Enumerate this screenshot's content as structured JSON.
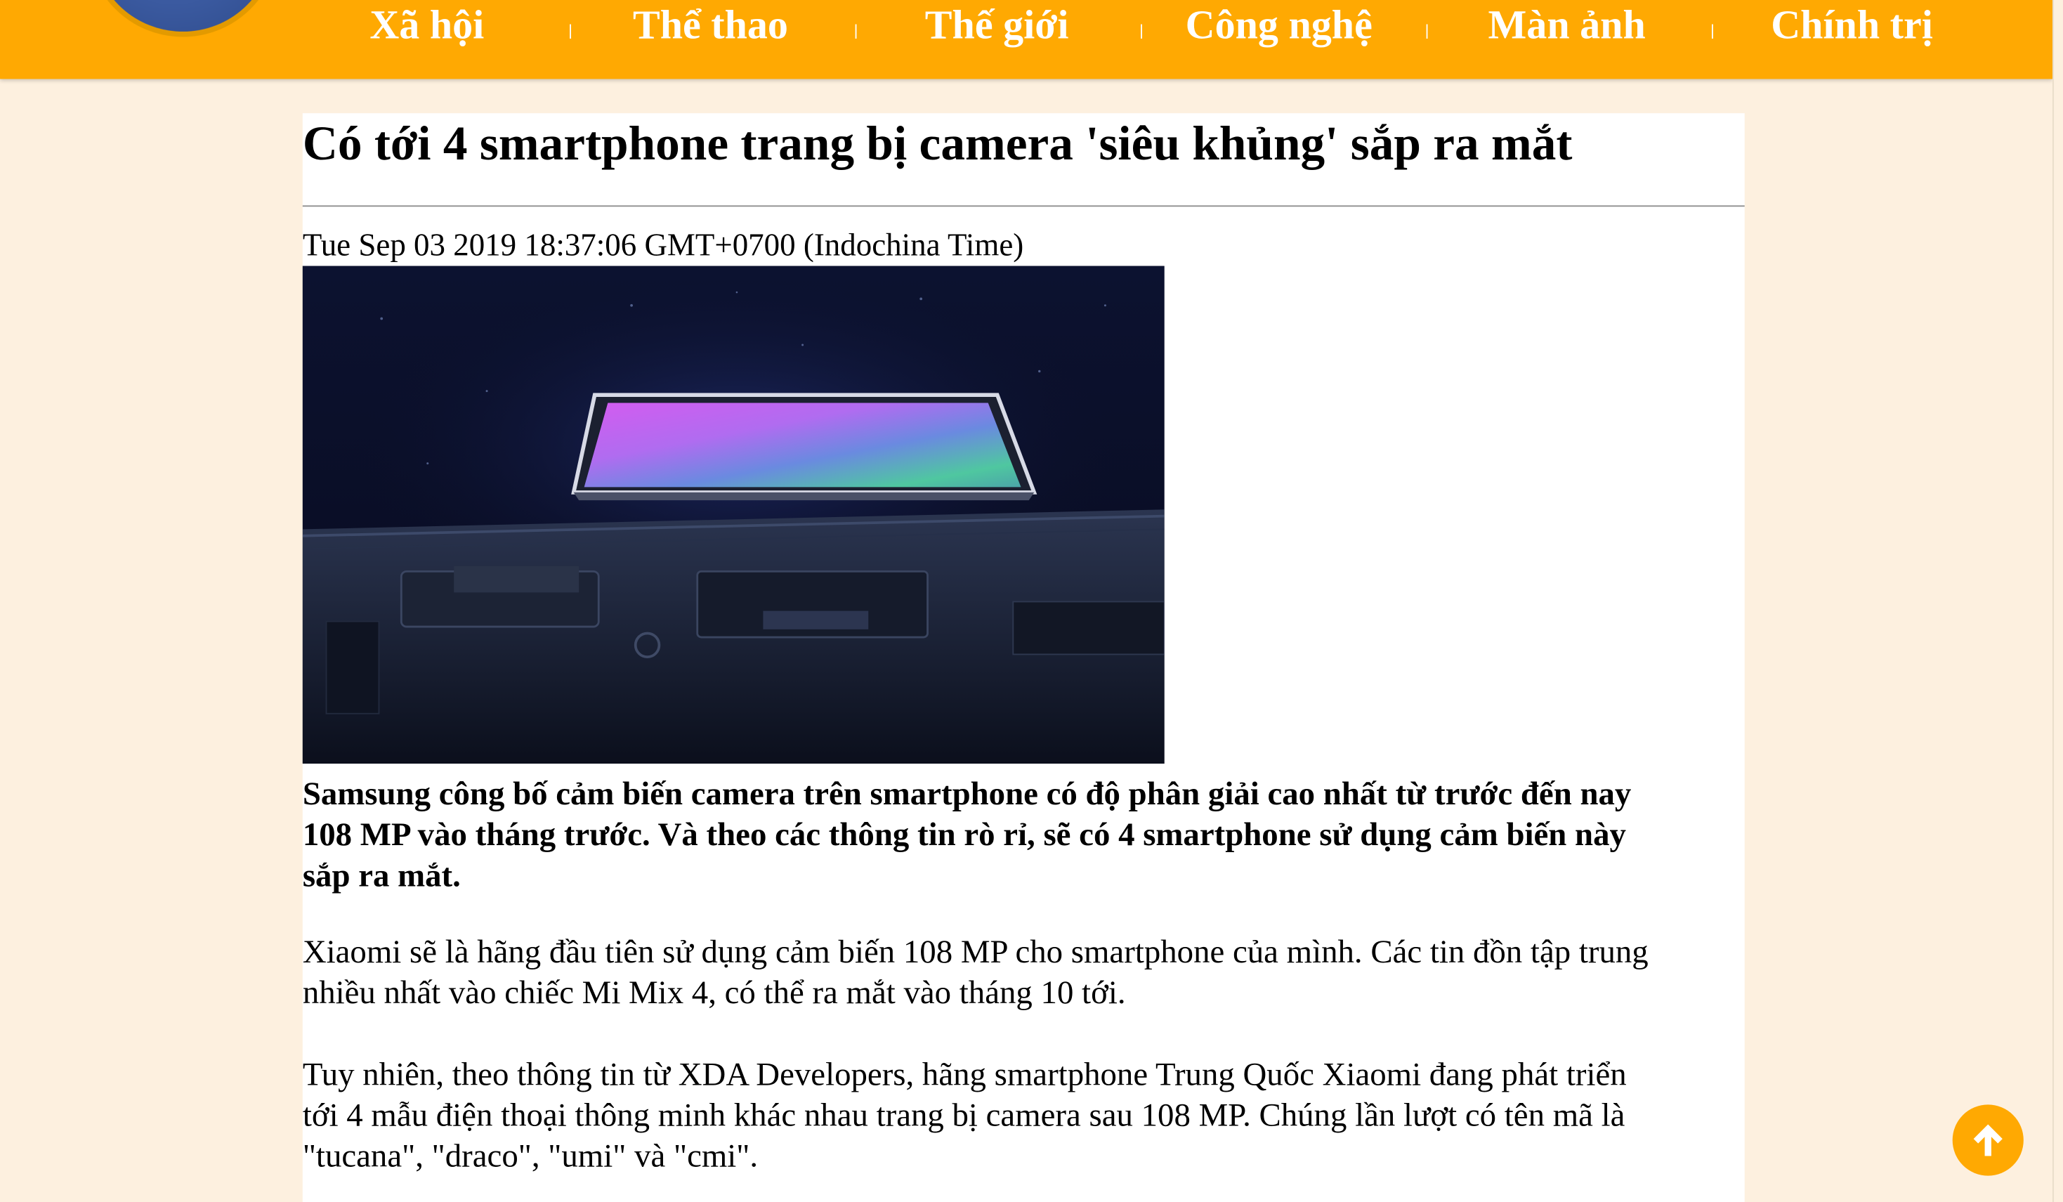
{
  "header": {
    "logo_alt": "logo",
    "nav": [
      {
        "label": "Xã hội"
      },
      {
        "label": "Thể thao"
      },
      {
        "label": "Thế giới"
      },
      {
        "label": "Công nghệ"
      },
      {
        "label": "Màn ảnh"
      },
      {
        "label": "Chính trị"
      }
    ],
    "separator": "|"
  },
  "article": {
    "title": "Có tới 4 smartphone trang bị camera 'siêu khủng' sắp ra mắt",
    "date": "Tue Sep 03 2019 18:37:06 GMT+0700 (Indochina Time)",
    "image_subject": "camera sensor chip above smartphone mainboard",
    "lead_lines": [
      "Samsung công bố cảm biến camera trên smartphone có độ phân giải cao nhất từ trước đến nay",
      "108 MP vào tháng trước. Và theo các thông tin rò rỉ, sẽ có 4 smartphone sử dụng cảm biến này",
      "sắp ra mắt."
    ],
    "paragraphs": [
      {
        "lines": [
          "Xiaomi sẽ là hãng đầu tiên sử dụng cảm biến 108 MP cho smartphone của mình. Các tin đồn tập trung",
          "nhiều nhất vào chiếc Mi Mix 4, có thể ra mắt vào tháng 10 tới."
        ]
      },
      {
        "lines": [
          "Tuy nhiên, theo thông tin từ XDA Developers, hãng smartphone Trung Quốc Xiaomi đang phát triển",
          "tới 4 mẫu điện thoại thông minh khác nhau trang bị camera sau 108 MP. Chúng lần lượt có tên mã là",
          "\"tucana\", \"draco\", \"umi\" và \"cmi\"."
        ]
      }
    ]
  },
  "back_to_top": {
    "icon": "arrow-up-icon"
  },
  "colors": {
    "header_bg": "#ffa902",
    "page_bg": "#fdf0df",
    "article_bg": "#ffffff",
    "nav_text": "#ffffff"
  }
}
